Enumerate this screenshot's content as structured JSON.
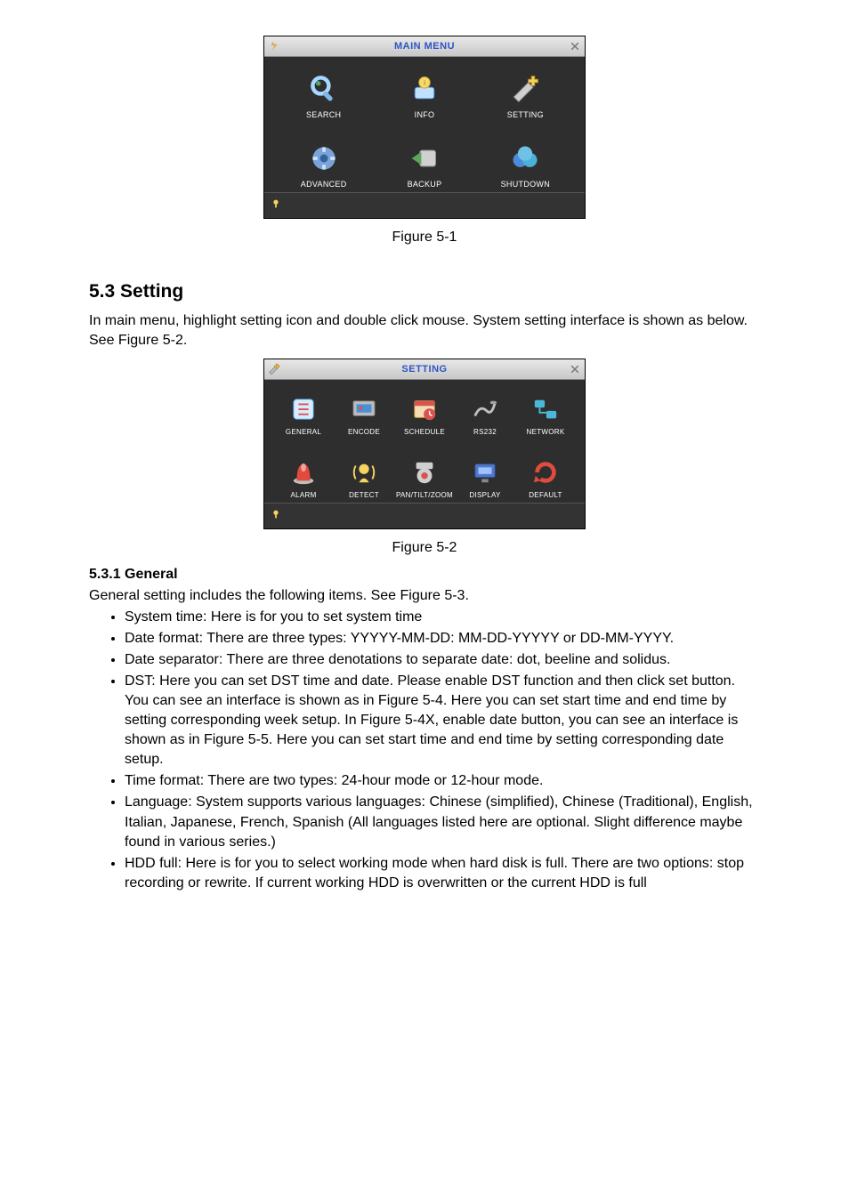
{
  "mainmenu": {
    "title": "MAIN MENU",
    "items": [
      {
        "label": "SEARCH"
      },
      {
        "label": "INFO"
      },
      {
        "label": "SETTING"
      },
      {
        "label": "ADVANCED"
      },
      {
        "label": "BACKUP"
      },
      {
        "label": "SHUTDOWN"
      }
    ]
  },
  "caption1": "Figure 5-1",
  "section_heading": "5.3  Setting",
  "section_para": "In main menu, highlight setting icon and double click mouse. System setting interface is shown as below. See Figure 5-2.",
  "settingmenu": {
    "title": "SETTING",
    "items": [
      {
        "label": "GENERAL"
      },
      {
        "label": "ENCODE"
      },
      {
        "label": "SCHEDULE"
      },
      {
        "label": "RS232"
      },
      {
        "label": "NETWORK"
      },
      {
        "label": "ALARM"
      },
      {
        "label": "DETECT"
      },
      {
        "label": "PAN/TILT/ZOOM"
      },
      {
        "label": "DISPLAY"
      },
      {
        "label": "DEFAULT"
      }
    ]
  },
  "caption2": "Figure 5-2",
  "subsection_heading": "5.3.1  General",
  "subsection_para": "General setting includes the following items. See Figure 5-3.",
  "bullets": [
    "System time: Here is for you to set system time",
    "Date format: There are three types: YYYYY-MM-DD: MM-DD-YYYYY or DD-MM-YYYY.",
    "Date separator: There are three denotations to separate date: dot, beeline and solidus.",
    "DST: Here you can set DST time and date. Please enable DST function and then click set button. You can see an interface is shown as in Figure 5-4. Here you can set start time and end time by setting corresponding week setup. In Figure 5-4X, enable date button, you can see an interface is shown as in Figure 5-5. Here you can set start time and end time by setting corresponding date setup.",
    "Time format: There are two types: 24-hour mode or 12-hour mode.",
    "Language: System supports various languages: Chinese (simplified), Chinese (Traditional), English, Italian, Japanese, French, Spanish (All languages listed here are optional. Slight difference maybe found in various series.)",
    "HDD full: Here is for you to select working mode when hard disk is full. There are two options: stop recording or rewrite. If current working HDD is overwritten or the current HDD is full"
  ]
}
